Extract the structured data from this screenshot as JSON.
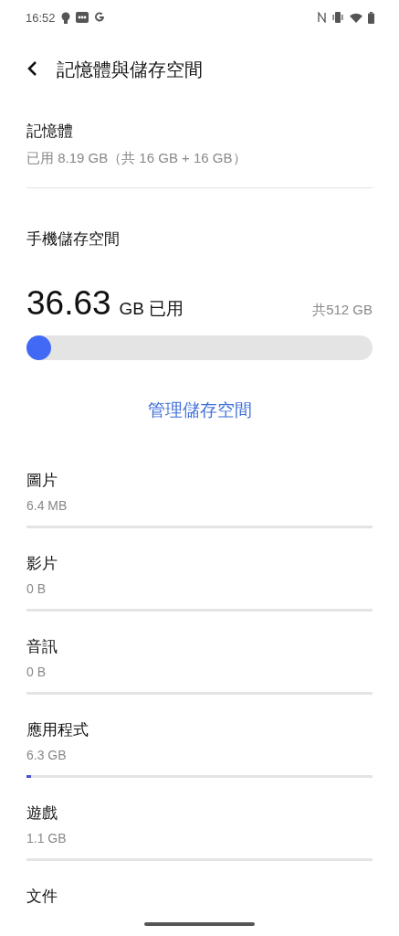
{
  "status_bar": {
    "time": "16:52"
  },
  "header": {
    "title": "記憶體與儲存空間"
  },
  "memory": {
    "title": "記憶體",
    "detail": "已用 8.19 GB（共 16 GB + 16 GB）"
  },
  "storage": {
    "title": "手機儲存空間",
    "used": "36.63",
    "used_unit": "GB 已用",
    "total": "共512 GB",
    "level": 0.0715
  },
  "manage_link": "管理儲存空間",
  "categories": [
    {
      "name": "圖片",
      "size": "6.4 MB",
      "level": 0
    },
    {
      "name": "影片",
      "size": "0 B",
      "level": 0
    },
    {
      "name": "音訊",
      "size": "0 B",
      "level": 0
    },
    {
      "name": "應用程式",
      "size": "6.3 GB",
      "level": 0.012
    },
    {
      "name": "遊戲",
      "size": "1.1 GB",
      "level": 0
    },
    {
      "name": "文件"
    }
  ]
}
